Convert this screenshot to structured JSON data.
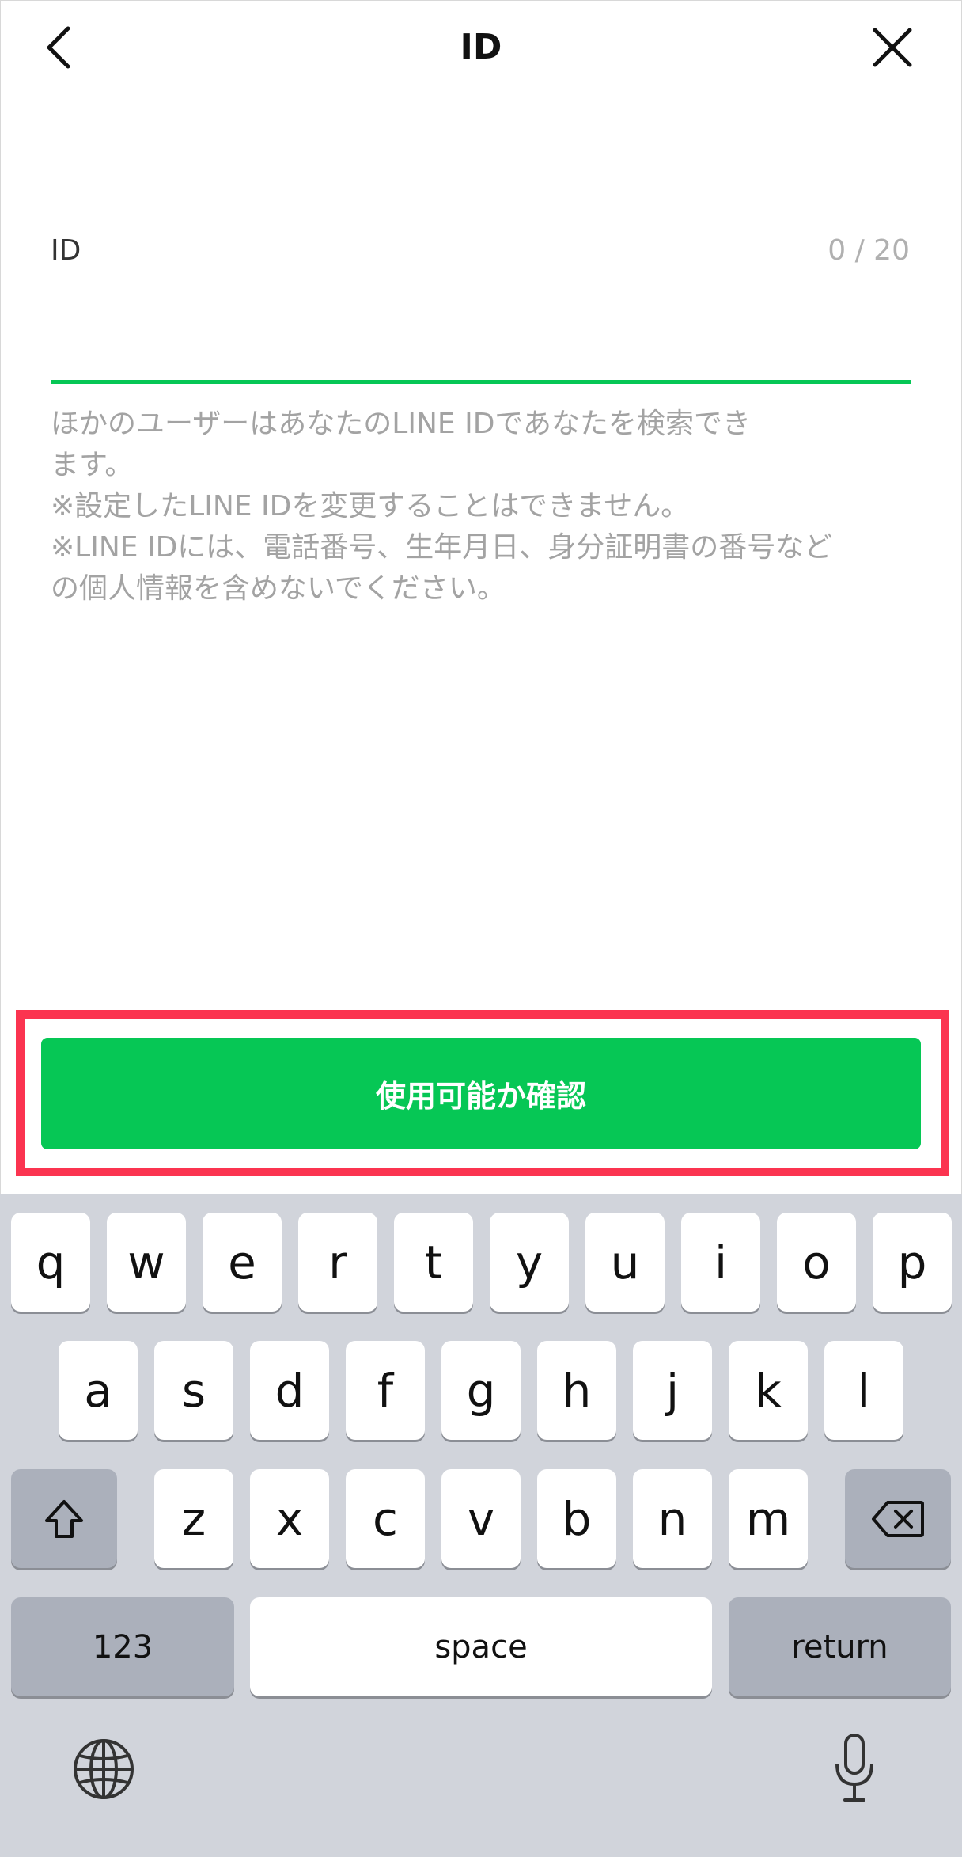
{
  "header": {
    "title": "ID",
    "back_icon": "chevron-left-icon",
    "close_icon": "close-icon"
  },
  "form": {
    "label": "ID",
    "counter": "0 / 20",
    "value": "",
    "helper_lines": [
      "ほかのユーザーはあなたのLINE IDであなたを検索でき",
      "ます。",
      "※設定したLINE IDを変更することはできません。",
      "※LINE IDには、電話番号、生年月日、身分証明書の番号など",
      "の個人情報を含めないでください。"
    ]
  },
  "check_button": {
    "label": "使用可能か確認"
  },
  "keyboard": {
    "row1": [
      "q",
      "w",
      "e",
      "r",
      "t",
      "y",
      "u",
      "i",
      "o",
      "p"
    ],
    "row2": [
      "a",
      "s",
      "d",
      "f",
      "g",
      "h",
      "j",
      "k",
      "l"
    ],
    "row3": [
      "z",
      "x",
      "c",
      "v",
      "b",
      "n",
      "m"
    ],
    "numbers_label": "123",
    "space_label": "space",
    "return_label": "return",
    "shift_icon": "shift-icon",
    "delete_icon": "delete-icon",
    "globe_icon": "globe-icon",
    "mic_icon": "microphone-icon"
  },
  "colors": {
    "accent_green": "#06c755",
    "highlight_red": "#fb3450",
    "keyboard_bg": "#d1d4db"
  }
}
